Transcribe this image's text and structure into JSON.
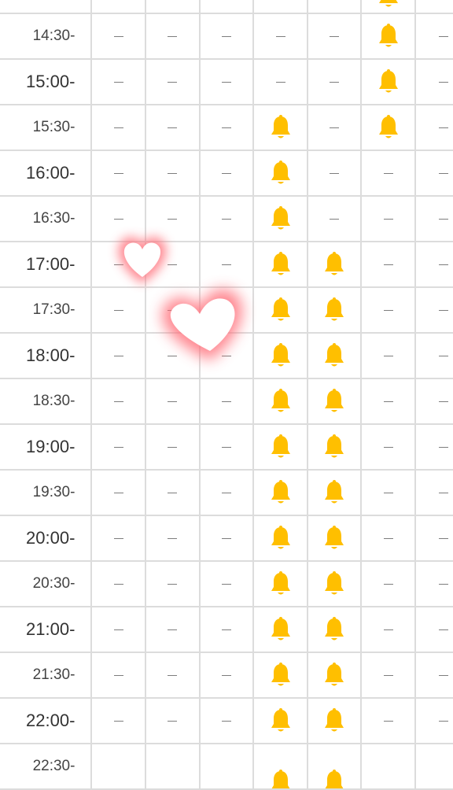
{
  "schedule": {
    "rows": [
      {
        "time": "",
        "slots": [
          "empty",
          "empty",
          "empty",
          "empty",
          "empty",
          "bell",
          "empty"
        ]
      },
      {
        "time": "14:30-",
        "slots": [
          "dash",
          "dash",
          "dash",
          "dash",
          "dash",
          "bell",
          "dash"
        ]
      },
      {
        "time": "15:00-",
        "slots": [
          "dash",
          "dash",
          "dash",
          "dash",
          "dash",
          "bell",
          "dash"
        ]
      },
      {
        "time": "15:30-",
        "slots": [
          "dash",
          "dash",
          "dash",
          "bell",
          "dash",
          "bell",
          "dash"
        ]
      },
      {
        "time": "16:00-",
        "slots": [
          "dash",
          "dash",
          "dash",
          "bell",
          "dash",
          "dash",
          "dash"
        ]
      },
      {
        "time": "16:30-",
        "slots": [
          "dash",
          "dash",
          "dash",
          "bell",
          "dash",
          "dash",
          "dash"
        ]
      },
      {
        "time": "17:00-",
        "slots": [
          "dash",
          "dash",
          "dash",
          "bell",
          "bell",
          "dash",
          "dash"
        ]
      },
      {
        "time": "17:30-",
        "slots": [
          "dash",
          "dash",
          "dash",
          "bell",
          "bell",
          "dash",
          "dash"
        ]
      },
      {
        "time": "18:00-",
        "slots": [
          "dash",
          "dash",
          "dash",
          "bell",
          "bell",
          "dash",
          "dash"
        ]
      },
      {
        "time": "18:30-",
        "slots": [
          "dash",
          "dash",
          "dash",
          "bell",
          "bell",
          "dash",
          "dash"
        ]
      },
      {
        "time": "19:00-",
        "slots": [
          "dash",
          "dash",
          "dash",
          "bell",
          "bell",
          "dash",
          "dash"
        ]
      },
      {
        "time": "19:30-",
        "slots": [
          "dash",
          "dash",
          "dash",
          "bell",
          "bell",
          "dash",
          "dash"
        ]
      },
      {
        "time": "20:00-",
        "slots": [
          "dash",
          "dash",
          "dash",
          "bell",
          "bell",
          "dash",
          "dash"
        ]
      },
      {
        "time": "20:30-",
        "slots": [
          "dash",
          "dash",
          "dash",
          "bell",
          "bell",
          "dash",
          "dash"
        ]
      },
      {
        "time": "21:00-",
        "slots": [
          "dash",
          "dash",
          "dash",
          "bell",
          "bell",
          "dash",
          "dash"
        ]
      },
      {
        "time": "21:30-",
        "slots": [
          "dash",
          "dash",
          "dash",
          "bell",
          "bell",
          "dash",
          "dash"
        ]
      },
      {
        "time": "22:00-",
        "slots": [
          "dash",
          "dash",
          "dash",
          "bell",
          "bell",
          "dash",
          "dash"
        ]
      },
      {
        "time": "22:30-",
        "slots": [
          "empty",
          "empty",
          "empty",
          "bell",
          "bell",
          "empty",
          "empty"
        ]
      }
    ]
  },
  "colors": {
    "bell": "#ffbf00",
    "grid_line": "#dcdcdc",
    "heart_glow": "#ff6f7a"
  },
  "icons": {
    "available": "bell-icon",
    "unavailable": "dash-icon",
    "sticker": "heart-icon"
  }
}
